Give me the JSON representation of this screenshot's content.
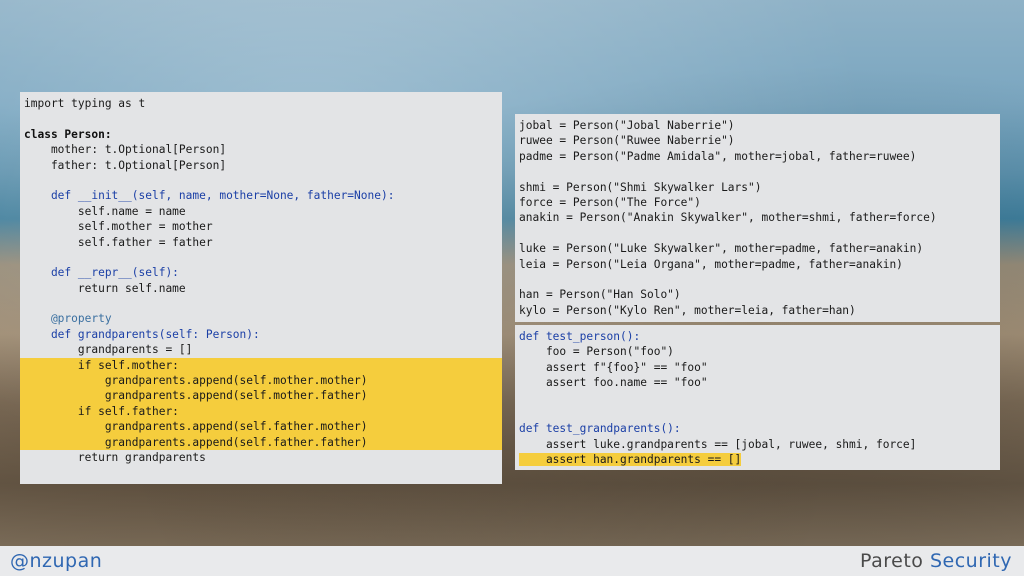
{
  "panels": {
    "left": {
      "lines": [
        "import typing as t",
        "",
        "class Person:",
        "    mother: t.Optional[Person]",
        "    father: t.Optional[Person]",
        "",
        "    def __init__(self, name, mother=None, father=None):",
        "        self.name = name",
        "        self.mother = mother",
        "        self.father = father",
        "",
        "    def __repr__(self):",
        "        return self.name",
        "",
        "    @property",
        "    def grandparents(self: Person):",
        "        grandparents = []",
        "        if self.mother:",
        "            grandparents.append(self.mother.mother)",
        "            grandparents.append(self.mother.father)",
        "        if self.father:",
        "            grandparents.append(self.father.mother)",
        "            grandparents.append(self.father.father)",
        "        return grandparents"
      ]
    },
    "right_top": {
      "lines": [
        "jobal = Person(\"Jobal Naberrie\")",
        "ruwee = Person(\"Ruwee Naberrie\")",
        "padme = Person(\"Padme Amidala\", mother=jobal, father=ruwee)",
        "",
        "shmi = Person(\"Shmi Skywalker Lars\")",
        "force = Person(\"The Force\")",
        "anakin = Person(\"Anakin Skywalker\", mother=shmi, father=force)",
        "",
        "luke = Person(\"Luke Skywalker\", mother=padme, father=anakin)",
        "leia = Person(\"Leia Organa\", mother=padme, father=anakin)",
        "",
        "han = Person(\"Han Solo\")",
        "kylo = Person(\"Kylo Ren\", mother=leia, father=han)"
      ]
    },
    "right_bottom": {
      "lines": [
        "def test_person():",
        "    foo = Person(\"foo\")",
        "    assert f\"{foo}\" == \"foo\"",
        "    assert foo.name == \"foo\"",
        "",
        "",
        "def test_grandparents():",
        "    assert luke.grandparents == [jobal, ruwee, shmi, force]",
        "    assert han.grandparents == []"
      ]
    }
  },
  "footer": {
    "handle": "@nzupan",
    "brand_part1": "Pareto",
    "brand_part2": "Security"
  },
  "colors": {
    "highlight": "#f5cd3d",
    "keyword_blue": "#1b3fa6",
    "string_red": "#b3271f",
    "accent_blue": "#2f67b2"
  }
}
